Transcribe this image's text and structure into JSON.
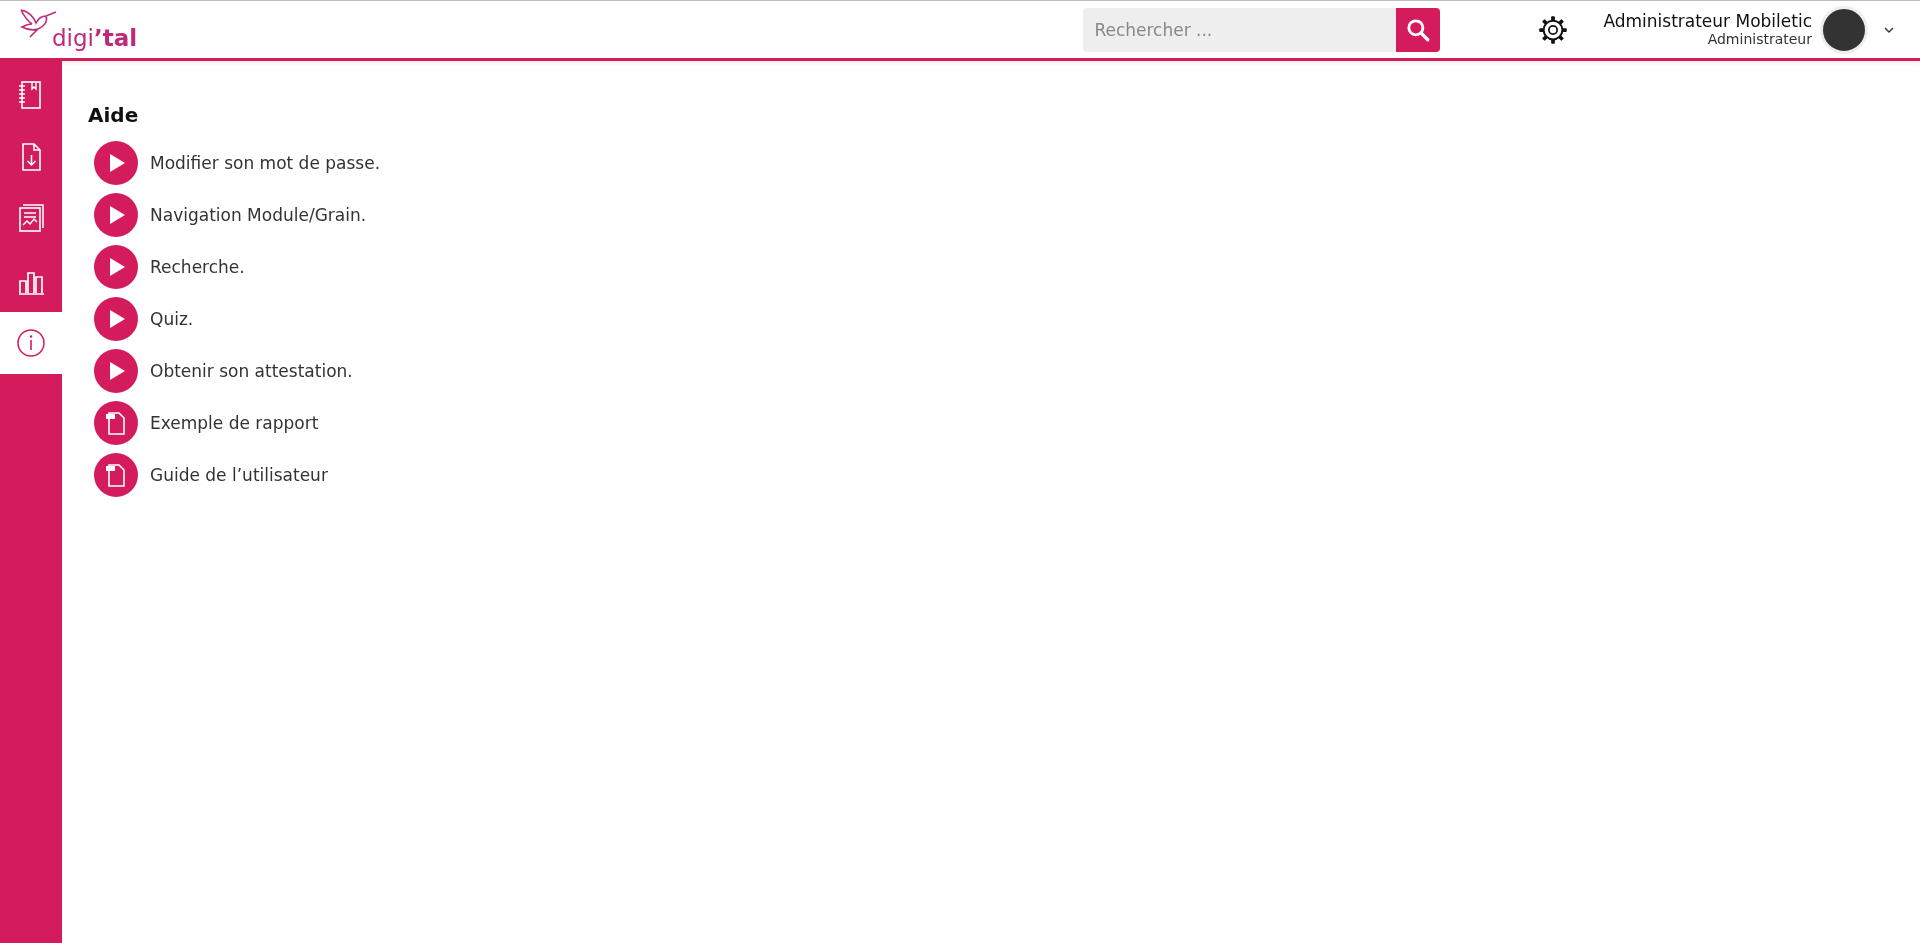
{
  "header": {
    "logo": "digi**’tal**",
    "search": {
      "placeholder": "Rechercher ..."
    },
    "user": {
      "name": "Administrateur Mobiletic",
      "role": "Administrateur"
    }
  },
  "sidebar": {
    "items": [
      {
        "kind": "notebook",
        "selected": false
      },
      {
        "kind": "download",
        "selected": false
      },
      {
        "kind": "report",
        "selected": false
      },
      {
        "kind": "chart",
        "selected": false
      },
      {
        "kind": "info",
        "selected": true
      }
    ]
  },
  "page": {
    "title": "Aide",
    "items": [
      {
        "kind": "video",
        "label": "Modifier son mot de passe."
      },
      {
        "kind": "video",
        "label": "Navigation Module/Grain."
      },
      {
        "kind": "video",
        "label": "Recherche."
      },
      {
        "kind": "video",
        "label": "Quiz."
      },
      {
        "kind": "video",
        "label": "Obtenir son attestation."
      },
      {
        "kind": "pdf",
        "label": "Exemple de rapport"
      },
      {
        "kind": "pdf",
        "label": "Guide de l’utilisateur"
      }
    ]
  }
}
